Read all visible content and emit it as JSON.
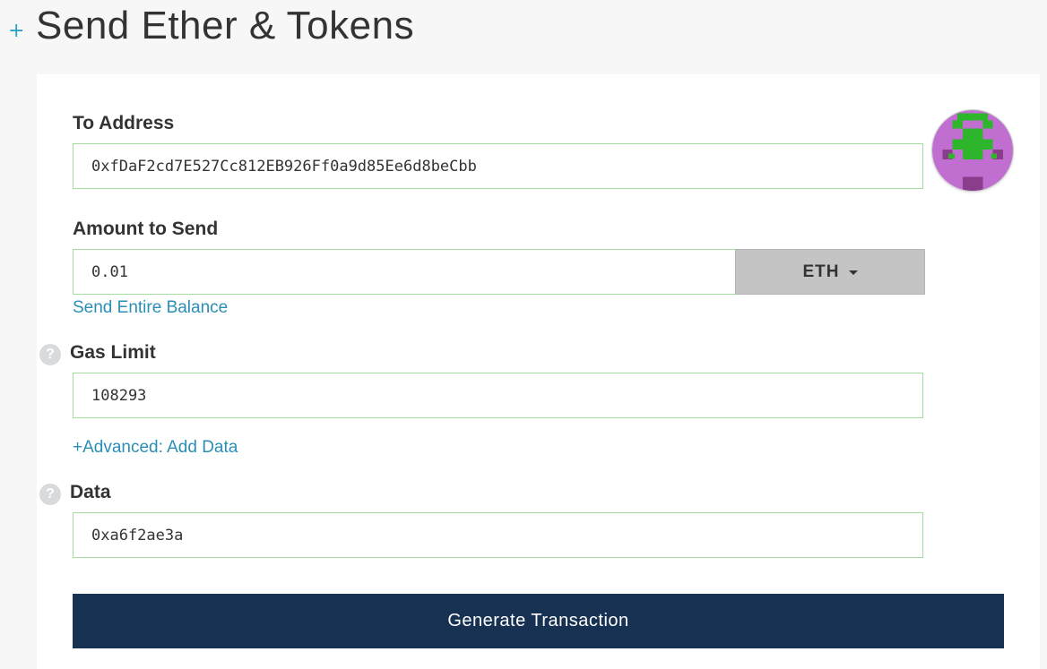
{
  "header": {
    "title": "Send Ether & Tokens",
    "plus_glyph": "+"
  },
  "form": {
    "to_address": {
      "label": "To Address",
      "value": "0xfDaF2cd7E527Cc812EB926Ff0a9d85Ee6d8beCbb"
    },
    "amount": {
      "label": "Amount to Send",
      "value": "0.01",
      "unit": "ETH",
      "send_entire_balance_link": "Send Entire Balance"
    },
    "gas_limit": {
      "label": "Gas Limit",
      "value": "108293",
      "help_glyph": "?"
    },
    "advanced_link": "+Advanced: Add Data",
    "data": {
      "label": "Data",
      "value": "0xa6f2ae3a",
      "help_glyph": "?"
    },
    "generate_button": "Generate Transaction"
  },
  "identicon": {
    "background": "#c06fd0",
    "primary": "#2db52b",
    "secondary": "#8a3d8a"
  },
  "colors": {
    "accent": "#2a8fb5",
    "button_bg": "#163151",
    "input_border": "#a5dca0",
    "dropdown_bg": "#c4c4c4"
  },
  "icons": {
    "plus": "plus-icon",
    "help": "question-mark-icon",
    "caret": "chevron-down-icon",
    "identicon": "address-identicon"
  }
}
